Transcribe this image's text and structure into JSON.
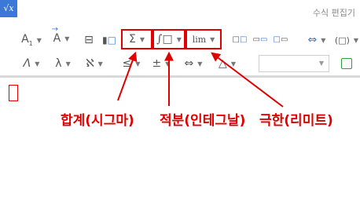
{
  "window": {
    "title": "수식 편집기",
    "icon_text": "√x"
  },
  "toolbar": {
    "row1": [
      {
        "name": "font-size-button",
        "glyph": "A",
        "sub": "1",
        "caret": true
      },
      {
        "name": "vector-accent-button",
        "glyph": "A",
        "caret": true
      },
      {
        "name": "fraction-button",
        "glyph": "⊟",
        "caret": false
      },
      {
        "name": "matrix-button",
        "glyph": "▯▯",
        "caret": false
      },
      {
        "name": "sigma-button",
        "glyph": "Σ",
        "caret": true
      },
      {
        "name": "integral-button",
        "glyph": "∫□",
        "caret": true
      },
      {
        "name": "limit-button",
        "glyph": "lim",
        "caret": true
      },
      {
        "name": "layout-button-1",
        "glyph": "⊡⊡",
        "caret": false
      },
      {
        "name": "layout-button-2",
        "glyph": "⊞⊞",
        "caret": false
      },
      {
        "name": "layout-button-3",
        "glyph": "⊟⊟",
        "caret": false
      },
      {
        "name": "arrow-grid-button",
        "glyph": "⇔",
        "caret": true
      },
      {
        "name": "paren-button",
        "glyph": "(□)",
        "caret": true
      }
    ],
    "row2": [
      {
        "name": "italic-greek-button",
        "glyph": "Λ",
        "caret": true
      },
      {
        "name": "lambda-button",
        "glyph": "λ",
        "caret": true
      },
      {
        "name": "aleph-button",
        "glyph": "ℵ",
        "caret": true
      },
      {
        "name": "relation-button",
        "glyph": "≤",
        "caret": true
      },
      {
        "name": "plusminus-button",
        "glyph": "±",
        "caret": true
      },
      {
        "name": "double-arrow-button",
        "glyph": "⇔",
        "caret": true
      },
      {
        "name": "triangle-button",
        "glyph": "△",
        "caret": true
      }
    ],
    "font_select_value": ""
  },
  "annotations": {
    "sigma": "합계(시그마)",
    "integral": "적분(인테그날)",
    "limit": "극한(리미트)"
  },
  "colors": {
    "annotation": "#e00000",
    "accent": "#3b7ad8",
    "green": "#2e9e43"
  }
}
